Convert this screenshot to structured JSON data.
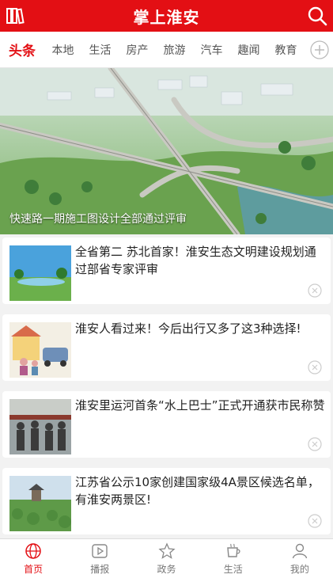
{
  "header": {
    "title": "掌上淮安",
    "menu_icon": "books-icon",
    "search_icon": "search-icon",
    "brand_color": "#e30f14"
  },
  "tabs": [
    {
      "label": "头条",
      "active": true
    },
    {
      "label": "本地"
    },
    {
      "label": "生活"
    },
    {
      "label": "房产"
    },
    {
      "label": "旅游"
    },
    {
      "label": "汽车"
    },
    {
      "label": "趣闻"
    },
    {
      "label": "教育"
    }
  ],
  "hero": {
    "caption": "快速路一期施工图设计全部通过评审"
  },
  "articles": [
    {
      "headline": "全省第二 苏北首家！淮安生态文明建设规划通过部省专家评审"
    },
    {
      "headline": "淮安人看过来！今后出行又多了这3种选择!"
    },
    {
      "headline": "淮安里运河首条“水上巴士”正式开通获市民称赞"
    },
    {
      "headline": "江苏省公示10家创建国家级4A景区候选名单，有淮安两景区!"
    }
  ],
  "bottom_nav": [
    {
      "label": "首页",
      "icon": "globe-icon",
      "active": true
    },
    {
      "label": "播报",
      "icon": "play-icon"
    },
    {
      "label": "政务",
      "icon": "star-icon"
    },
    {
      "label": "生活",
      "icon": "cup-icon"
    },
    {
      "label": "我的",
      "icon": "user-icon"
    }
  ]
}
